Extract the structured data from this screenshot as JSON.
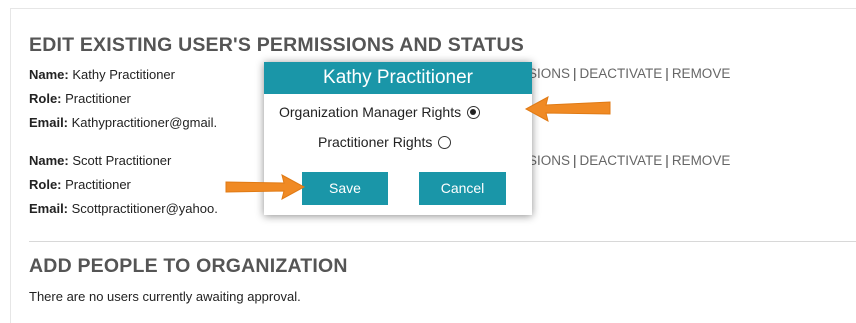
{
  "edit_section": {
    "title": "EDIT EXISTING USER'S PERMISSIONS AND STATUS",
    "users": [
      {
        "name_label": "Name:",
        "name": "Kathy Practitioner",
        "role_label": "Role:",
        "role": "Practitioner",
        "email_label": "Email:",
        "email": "Kathypractitioner@gmail.",
        "actions_partial": "SIONS",
        "sep1": "|",
        "deactivate": "DEACTIVATE",
        "sep2": "|",
        "remove": "REMOVE"
      },
      {
        "name_label": "Name:",
        "name": "Scott Practitioner",
        "role_label": "Role:",
        "role": "Practitioner",
        "email_label": "Email:",
        "email": "Scottpractitioner@yahoo.",
        "actions_partial": "SIONS",
        "sep1": "|",
        "deactivate": "DEACTIVATE",
        "sep2": "|",
        "remove": "REMOVE"
      }
    ]
  },
  "add_section": {
    "title": "ADD PEOPLE TO ORGANIZATION",
    "message": "There are no users currently awaiting approval."
  },
  "modal": {
    "title": "Kathy Practitioner",
    "options": [
      {
        "label": "Organization Manager Rights",
        "selected": true
      },
      {
        "label": "Practitioner Rights",
        "selected": false
      }
    ],
    "save_label": "Save",
    "cancel_label": "Cancel"
  },
  "colors": {
    "accent": "#1a96a8",
    "arrow": "#f08a24"
  }
}
